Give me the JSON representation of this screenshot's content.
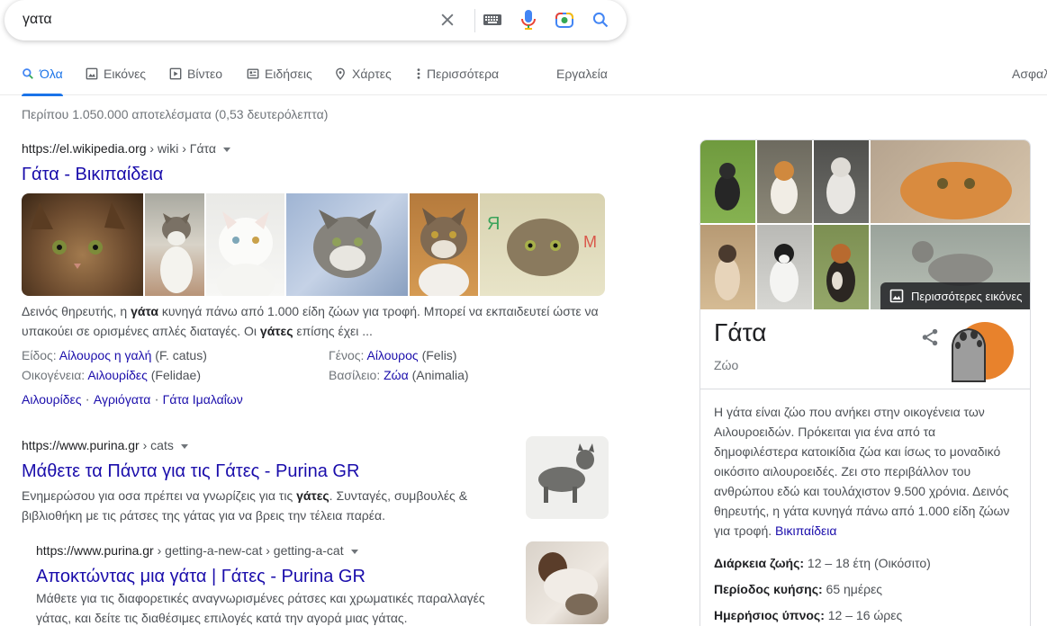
{
  "search": {
    "query": "γατα"
  },
  "tabs": [
    {
      "label": "Όλα",
      "icon": "search-icon"
    },
    {
      "label": "Εικόνες",
      "icon": "image-icon"
    },
    {
      "label": "Βίντεο",
      "icon": "video-icon"
    },
    {
      "label": "Ειδήσεις",
      "icon": "news-icon"
    },
    {
      "label": "Χάρτες",
      "icon": "map-pin-icon"
    },
    {
      "label": "Περισσότερα",
      "icon": "more-vert-icon"
    }
  ],
  "tools_label": "Εργαλεία",
  "safesearch_label": "Ασφαλ",
  "result_stats": "Περίπου 1.050.000 αποτελέσματα (0,53 δευτερόλεπτα)",
  "results": [
    {
      "cite_domain": "https://el.wikipedia.org",
      "cite_path": " › wiki › Γάτα",
      "title": "Γάτα - Βικιπαίδεια",
      "snippet_parts": [
        "Δεινός θηρευτής, η ",
        "γάτα",
        " κυνηγά πάνω από 1.000 είδη ζώων για τροφή. Μπορεί να εκπαιδευτεί ώστε να υπακούει σε ορισμένες απλές διαταγές. Οι ",
        "γάτες",
        " επίσης έχει ..."
      ],
      "facts": [
        {
          "label": "Είδος: ",
          "link": "Αίλουρος η γαλή",
          "extra": " (F. catus)"
        },
        {
          "label": "Γένος: ",
          "link": "Αίλουρος",
          "extra": " (Felis)"
        },
        {
          "label": "Οικογένεια: ",
          "link": "Αιλουρίδες",
          "extra": " (Felidae)"
        },
        {
          "label": "Βασίλειο: ",
          "link": "Ζώα",
          "extra": " (Animalia)"
        }
      ],
      "related": [
        "Αιλουρίδες",
        "Αγριόγατα",
        "Γάτα Ιμαλαΐων"
      ]
    },
    {
      "cite_domain": "https://www.purina.gr",
      "cite_path": " › cats",
      "title": "Μάθετε τα Πάντα για τις Γάτες - Purina GR",
      "snippet_parts": [
        "Ενημερώσου για οσα πρέπει να γνωρίζεις για τις ",
        "γάτες",
        ". Συνταγές, συμβουλές & βιβλιοθήκη με τις ράτσες της γάτας για να βρεις την τέλεια παρέα."
      ]
    },
    {
      "cite_domain": "https://www.purina.gr",
      "cite_path": " › getting-a-new-cat › getting-a-cat",
      "title": "Αποκτώντας μια γάτα | Γάτες - Purina GR",
      "snippet": "Μάθετε για τις διαφορετικές αναγνωρισμένες ράτσες και χρωματικές παραλλαγές γάτας, και δείτε τις διαθέσιμες επιλογές κατά την αγορά μιας γάτας."
    }
  ],
  "knowledge_panel": {
    "more_images_label": "Περισσότερες εικόνες",
    "title": "Γάτα",
    "subtitle": "Ζώο",
    "description": "Η γάτα είναι ζώο που ανήκει στην οικογένεια των Αιλουροειδών. Πρόκειται για ένα από τα δημοφιλέστερα κατοικίδια ζώα και ίσως το μοναδικό οικόσιτο αιλουροειδές. Ζει στο περιβάλλον του ανθρώπου εδώ και τουλάχιστον 9.500 χρόνια. Δεινός θηρευτής, η γάτα κυνηγά πάνω από 1.000 είδη ζώων για τροφή. ",
    "source_link": "Βικιπαίδεια",
    "facts": [
      {
        "label": "Διάρκεια ζωής:",
        "value": " 12 – 18 έτη (Οικόσιτο)"
      },
      {
        "label": "Περίοδος κυήσης:",
        "value": " 65 ημέρες"
      },
      {
        "label": "Ημερήσιος ύπνος:",
        "value": " 12 – 16 ώρες"
      }
    ]
  }
}
